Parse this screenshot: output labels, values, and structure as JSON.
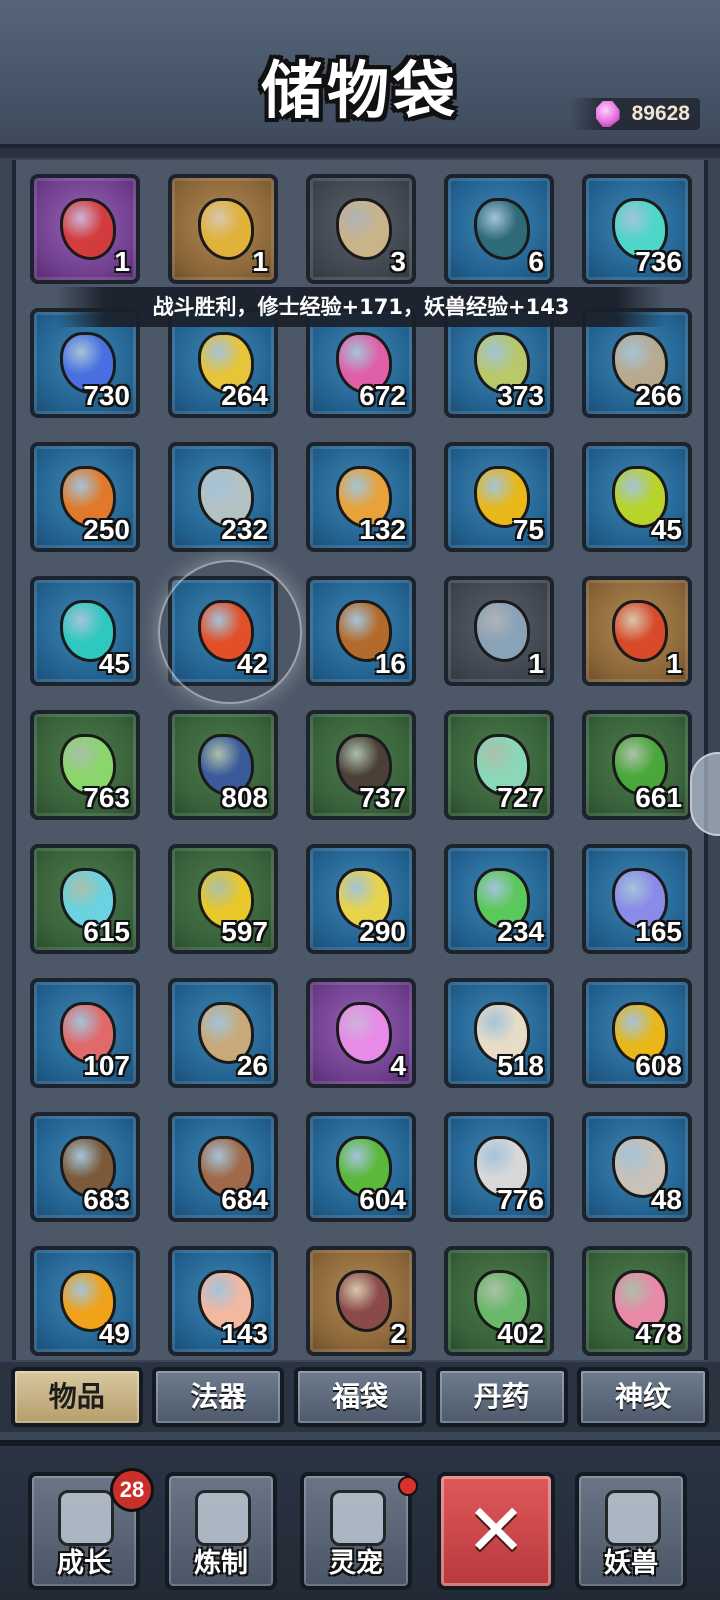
{
  "header": {
    "title": "储物袋",
    "currency_value": "89628",
    "currency_icon": "spirit-gem-icon"
  },
  "banner": "战斗胜利，修士经验+171，妖兽经验+143",
  "items": [
    {
      "icon": "heart-icon",
      "count": "1",
      "bg": "purple",
      "color": "#d23c3c"
    },
    {
      "icon": "yin-yang-amulet-icon",
      "count": "1",
      "bg": "gold",
      "color": "#e0b23a"
    },
    {
      "icon": "sand-pile-icon",
      "count": "3",
      "bg": "gray",
      "color": "#c9b48a"
    },
    {
      "icon": "cracked-egg-icon",
      "count": "6",
      "bg": "blue",
      "color": "#2e6a78"
    },
    {
      "icon": "teal-crystal-icon",
      "count": "736",
      "bg": "blue",
      "color": "#4fd6c8"
    },
    {
      "icon": "blue-crystal-icon",
      "count": "730",
      "bg": "blue",
      "color": "#4a6fe0"
    },
    {
      "icon": "yellow-crystal-icon",
      "count": "264",
      "bg": "blue",
      "color": "#e8c43a"
    },
    {
      "icon": "pink-crystal-icon",
      "count": "672",
      "bg": "blue",
      "color": "#e060a8"
    },
    {
      "icon": "leafy-stone-icon",
      "count": "373",
      "bg": "blue",
      "color": "#b8c86a"
    },
    {
      "icon": "tan-stone-icon",
      "count": "266",
      "bg": "blue",
      "color": "#b8aa8e"
    },
    {
      "icon": "orange-ore-icon",
      "count": "250",
      "bg": "blue",
      "color": "#e07a2a"
    },
    {
      "icon": "gray-ore-icon",
      "count": "232",
      "bg": "blue",
      "color": "#b4c2c4"
    },
    {
      "icon": "amber-ore-icon",
      "count": "132",
      "bg": "blue",
      "color": "#e8a23a"
    },
    {
      "icon": "gold-pebble-icon",
      "count": "75",
      "bg": "blue",
      "color": "#e8b81a"
    },
    {
      "icon": "lime-pebble-icon",
      "count": "45",
      "bg": "blue",
      "color": "#b8d42a"
    },
    {
      "icon": "cyan-pebble-icon",
      "count": "45",
      "bg": "blue",
      "color": "#2ec8c0"
    },
    {
      "icon": "red-pebble-icon",
      "count": "42",
      "bg": "blue",
      "color": "#e2502a",
      "hilite": true
    },
    {
      "icon": "brown-pebble-icon",
      "count": "16",
      "bg": "blue",
      "color": "#b46a2a"
    },
    {
      "icon": "sickle-blade-icon",
      "count": "1",
      "bg": "gray",
      "color": "#8aa2b8"
    },
    {
      "icon": "flame-mace-icon",
      "count": "1",
      "bg": "gold",
      "color": "#d84a2a"
    },
    {
      "icon": "bamboo-icon",
      "count": "763",
      "bg": "green",
      "color": "#8ad66a"
    },
    {
      "icon": "navy-shard-icon",
      "count": "808",
      "bg": "green",
      "color": "#3a5a9a"
    },
    {
      "icon": "dark-shard-icon",
      "count": "737",
      "bg": "green",
      "color": "#4a4038"
    },
    {
      "icon": "jade-shard-icon",
      "count": "727",
      "bg": "green",
      "color": "#8ad8b8"
    },
    {
      "icon": "green-shard-icon",
      "count": "661",
      "bg": "green",
      "color": "#4aa83a"
    },
    {
      "icon": "ice-shard-icon",
      "count": "615",
      "bg": "green",
      "color": "#6ad2e0"
    },
    {
      "icon": "gold-shard-icon",
      "count": "597",
      "bg": "green",
      "color": "#e8c82a"
    },
    {
      "icon": "yellow-seed-icon",
      "count": "290",
      "bg": "blue",
      "color": "#e8d44a"
    },
    {
      "icon": "green-seed-icon",
      "count": "234",
      "bg": "blue",
      "color": "#5ac85a"
    },
    {
      "icon": "violet-seed-icon",
      "count": "165",
      "bg": "blue",
      "color": "#8a8ae8"
    },
    {
      "icon": "rose-seed-icon",
      "count": "107",
      "bg": "blue",
      "color": "#e06a6a"
    },
    {
      "icon": "sand-seed-icon",
      "count": "26",
      "bg": "blue",
      "color": "#c8aa7a"
    },
    {
      "icon": "spiral-crystal-icon",
      "count": "4",
      "bg": "purple",
      "color": "#e88ae8"
    },
    {
      "icon": "horn-icon",
      "count": "518",
      "bg": "blue",
      "color": "#e8dcc8"
    },
    {
      "icon": "honey-jar-icon",
      "count": "608",
      "bg": "blue",
      "color": "#e8b81a"
    },
    {
      "icon": "rope-coil-icon",
      "count": "683",
      "bg": "blue",
      "color": "#7a5a3a"
    },
    {
      "icon": "leather-hide-icon",
      "count": "684",
      "bg": "blue",
      "color": "#a06a4a"
    },
    {
      "icon": "leaf-icon",
      "count": "604",
      "bg": "blue",
      "color": "#5ab83a"
    },
    {
      "icon": "feather-icon",
      "count": "776",
      "bg": "blue",
      "color": "#d8d8d8"
    },
    {
      "icon": "bone-icon",
      "count": "48",
      "bg": "blue",
      "color": "#c8c2b8"
    },
    {
      "icon": "amber-gem-icon",
      "count": "49",
      "bg": "blue",
      "color": "#f0a21a"
    },
    {
      "icon": "seashell-icon",
      "count": "143",
      "bg": "blue",
      "color": "#f2b8a2"
    },
    {
      "icon": "scaled-hide-icon",
      "count": "2",
      "bg": "gold",
      "color": "#8a4a4a"
    },
    {
      "icon": "herb-bundle-icon",
      "count": "402",
      "bg": "green",
      "color": "#6ab86a"
    },
    {
      "icon": "mushroom-icon",
      "count": "478",
      "bg": "green",
      "color": "#e88aa8"
    }
  ],
  "tabs": [
    {
      "label": "物品",
      "active": true
    },
    {
      "label": "法器",
      "active": false
    },
    {
      "label": "福袋",
      "active": false
    },
    {
      "label": "丹药",
      "active": false
    },
    {
      "label": "神纹",
      "active": false
    }
  ],
  "nav": {
    "growth": {
      "label": "成长",
      "icon": "card-stack-icon",
      "badge": "28"
    },
    "craft": {
      "label": "炼制",
      "icon": "anvil-hammer-icon"
    },
    "pet": {
      "label": "灵宠",
      "icon": "pet-egg-icon"
    },
    "close": {
      "label": "✕",
      "icon": "close-icon"
    },
    "beast": {
      "label": "妖兽",
      "icon": "beast-cat-icon"
    }
  }
}
